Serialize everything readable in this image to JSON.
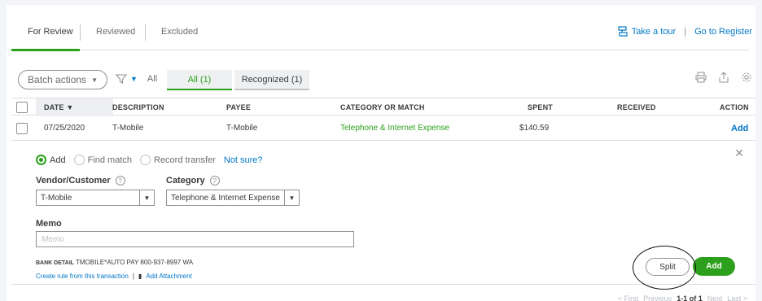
{
  "tabs": [
    "For Review",
    "Reviewed",
    "Excluded"
  ],
  "top_links": {
    "tour": "Take a tour",
    "separator": "|",
    "register": "Go to Register"
  },
  "toolbar": {
    "batch_actions": "Batch actions",
    "filter_label": "All",
    "segment_all": "All (1)",
    "segment_recognized": "Recognized (1)"
  },
  "table": {
    "headers": {
      "date": "DATE ▼",
      "description": "DESCRIPTION",
      "payee": "PAYEE",
      "category": "CATEGORY OR MATCH",
      "spent": "SPENT",
      "received": "RECEIVED",
      "action": "ACTION"
    },
    "row": {
      "date": "07/25/2020",
      "description": "T-Mobile",
      "payee": "T-Mobile",
      "category": "Telephone & Internet Expense",
      "spent": "$140.59",
      "received": "",
      "action": "Add"
    }
  },
  "panel": {
    "radio_add": "Add",
    "radio_find": "Find match",
    "radio_transfer": "Record transfer",
    "not_sure": "Not sure?",
    "vendor_label": "Vendor/Customer",
    "vendor_value": "T-Mobile",
    "category_label": "Category",
    "category_value": "Telephone & Internet Expense",
    "memo_label": "Memo",
    "memo_placeholder": "Memo",
    "bank_detail_label": "BANK DETAIL",
    "bank_detail_value": "TMOBILE*AUTO PAY 800-937-8997 WA",
    "create_rule": "Create rule from this transaction",
    "rule_sep": "|",
    "add_attachment": "Add Attachment",
    "split": "Split",
    "add": "Add"
  },
  "pager": {
    "first": "< First",
    "previous": "Previous",
    "range": "1-1 of 1",
    "next": "Next",
    "last": "Last >"
  },
  "colors": {
    "accent_green": "#2ca01c",
    "link_blue": "#0077c5"
  }
}
